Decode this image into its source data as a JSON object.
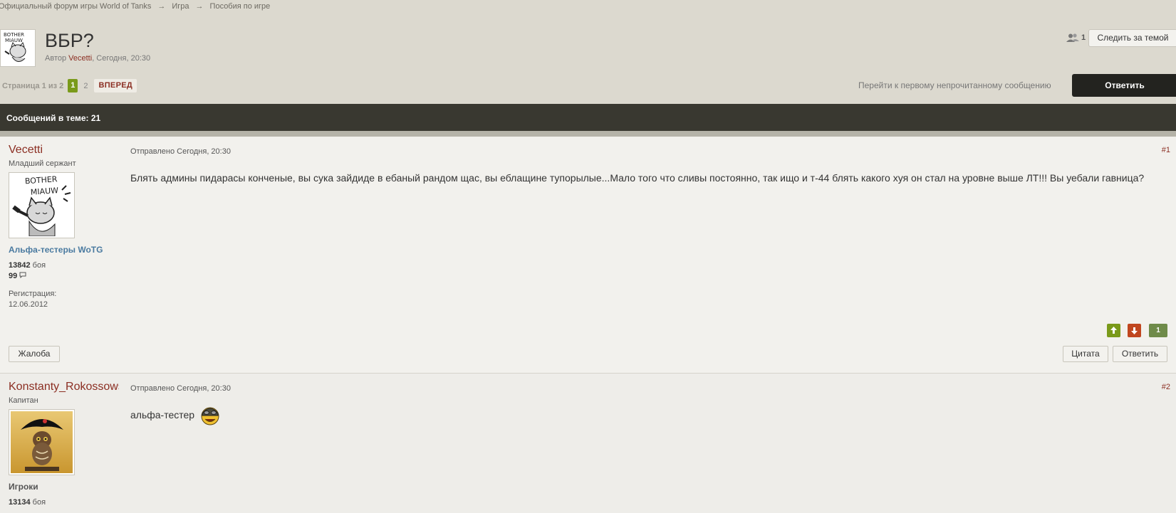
{
  "breadcrumb": {
    "items": [
      "Официальный форум игры World of Tanks",
      "Игра",
      "Пособия по игре"
    ],
    "separator": "→"
  },
  "topic": {
    "title": "ВБР?",
    "meta_prefix": "Автор",
    "author": "Vecetti",
    "meta_suffix": ", Сегодня, 20:30",
    "followers_count": "1",
    "follow_label": "Следить за темой"
  },
  "pagination": {
    "label": "Страница 1 из 2",
    "current": "1",
    "next_page": "2",
    "next_label": "ВПЕРЕД"
  },
  "actions": {
    "first_unread": "Перейти к первому непрочитанному сообщению",
    "reply": "Ответить"
  },
  "posts_count_label": "Сообщений в теме: 21",
  "posts": [
    {
      "author": "Vecetti",
      "rank": "Младший сержант",
      "group": "Альфа-тестеры WoTG",
      "battles": "13842",
      "battles_label": "боя",
      "posts": "99",
      "reg_label": "Регистрация:",
      "reg_date": "12.06.2012",
      "date": "Отправлено Сегодня, 20:30",
      "number": "#1",
      "body": "Блять админы пидарасы конченые, вы сука зайдиде в ебаный рандом щас, вы еблащине тупорылые...Мало того что сливы постоянно, так ищо и т-44 блять какого хуя он стал на уровне выше ЛТ!!! Вы уебали гавница?",
      "rating": "1",
      "report_label": "Жалоба",
      "quote_label": "Цитата",
      "reply_label": "Ответить"
    },
    {
      "author": "Konstanty_Rokossowski",
      "rank": "Капитан",
      "group": "Игроки",
      "battles": "13134",
      "battles_label": "боя",
      "date": "Отправлено Сегодня, 20:30",
      "number": "#2",
      "body": "альфа-тестер"
    }
  ],
  "colors": {
    "background": "#dcd9cf",
    "accent_red": "#8b2e22",
    "dark_bar": "#393830",
    "page_green": "#7a9a1a"
  },
  "icons": {
    "followers": "users-icon",
    "comments": "comment-icon",
    "vote_up": "arrow-up-icon",
    "vote_down": "arrow-down-icon",
    "emoticon": "tanker-smiley-icon"
  }
}
